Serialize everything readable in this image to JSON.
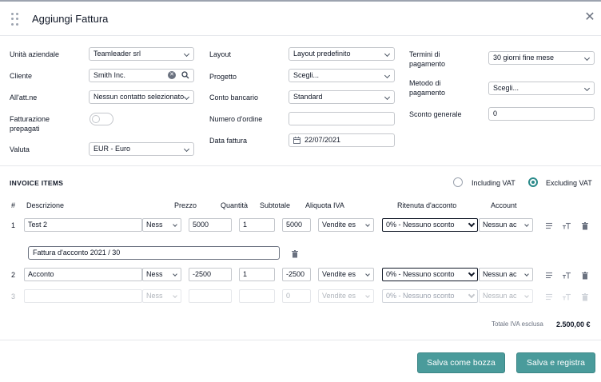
{
  "modal": {
    "title": "Aggiungi Fattura"
  },
  "form": {
    "unita_label": "Unità aziendale",
    "unita_value": "Teamleader srl",
    "cliente_label": "Cliente",
    "cliente_value": "Smith Inc.",
    "att_label": "All'att.ne",
    "att_value": "Nessun contatto selezionato",
    "fatturazione_label_1": "Fatturazione",
    "fatturazione_label_2": "prepagati",
    "valuta_label": "Valuta",
    "valuta_value": "EUR - Euro",
    "layout_label": "Layout",
    "layout_value": "Layout predefinito",
    "progetto_label": "Progetto",
    "progetto_value": "Scegli...",
    "conto_label": "Conto bancario",
    "conto_value": "Standard",
    "ordine_label": "Numero d'ordine",
    "ordine_value": "",
    "data_label": "Data fattura",
    "data_value": "22/07/2021",
    "termini_label_1": "Termini di",
    "termini_label_2": "pagamento",
    "termini_value": "30 giorni fine mese",
    "metodo_label_1": "Metodo di",
    "metodo_label_2": "pagamento",
    "metodo_value": "Scegli...",
    "sconto_label": "Sconto generale",
    "sconto_value": "0"
  },
  "items": {
    "title": "INVOICE ITEMS",
    "including_vat": "Including VAT",
    "excluding_vat": "Excluding VAT",
    "vat_mode": "excluding",
    "headers": {
      "num": "#",
      "descrizione": "Descrizione",
      "prezzo": "Prezzo",
      "quantita": "Quantità",
      "subtotale": "Subtotale",
      "aliquota": "Aliquota IVA",
      "ritenuta": "Ritenuta d'acconto",
      "account": "Account"
    },
    "rows": [
      {
        "num": "1",
        "descrizione": "Test 2",
        "unit": "Ness",
        "prezzo": "5000",
        "quantita": "1",
        "subtotale": "5000",
        "aliquota": "Vendite es",
        "ritenuta": "0% - Nessuno sconto",
        "account": "Nessun ac"
      },
      {
        "num": "2",
        "descrizione": "Acconto",
        "unit": "Ness",
        "prezzo": "-2500",
        "quantita": "1",
        "subtotale": "-2500",
        "aliquota": "Vendite es",
        "ritenuta": "0% - Nessuno sconto",
        "account": "Nessun ac"
      },
      {
        "num": "3",
        "descrizione": "",
        "unit": "Ness",
        "prezzo": "",
        "quantita": "",
        "subtotale": "0",
        "aliquota": "Vendite es",
        "ritenuta": "0% - Nessuno sconto",
        "account": "Nessun ac"
      }
    ],
    "note_value": "Fattura d'acconto 2021 / 30",
    "total_label": "Totale IVA esclusa",
    "total_value": "2.500,00 €"
  },
  "footer": {
    "draft_label": "Salva come bozza",
    "save_label": "Salva e registra"
  },
  "colors": {
    "accent": "#4a9b9b"
  }
}
